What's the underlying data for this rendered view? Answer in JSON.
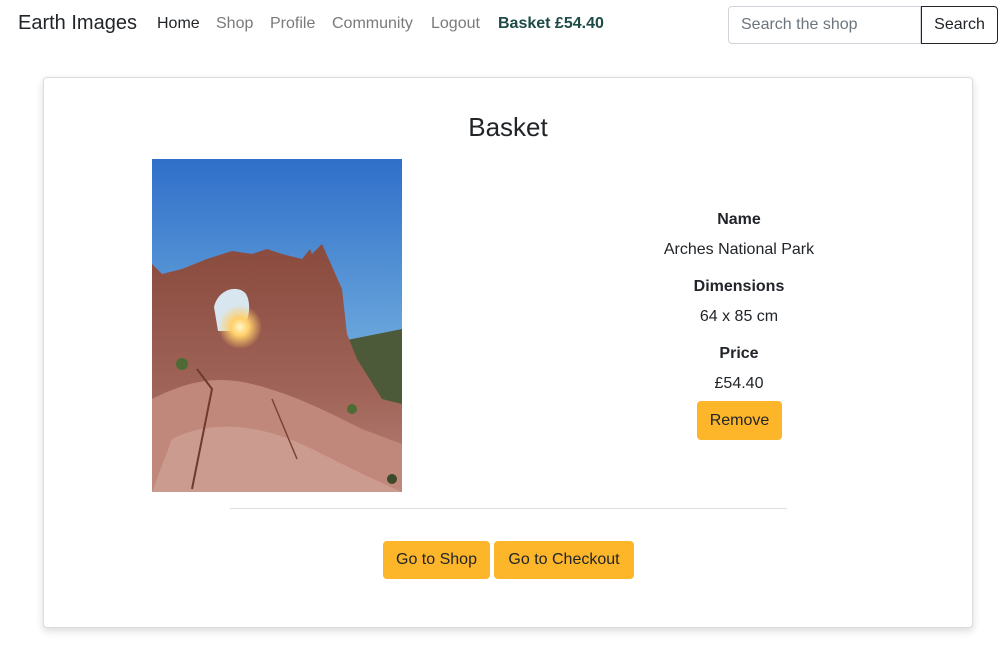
{
  "navbar": {
    "brand": "Earth Images",
    "links": [
      "Home",
      "Shop",
      "Profile",
      "Community",
      "Logout"
    ],
    "basket": "Basket £54.40",
    "search_placeholder": "Search the shop",
    "search_button": "Search"
  },
  "basket": {
    "title": "Basket",
    "item": {
      "name_label": "Name",
      "name": "Arches National Park",
      "dimensions_label": "Dimensions",
      "dimensions": "64 x 85 cm",
      "price_label": "Price",
      "price": "£54.40",
      "remove_button": "Remove"
    },
    "shop_button": "Go to Shop",
    "checkout_button": "Go to Checkout"
  }
}
